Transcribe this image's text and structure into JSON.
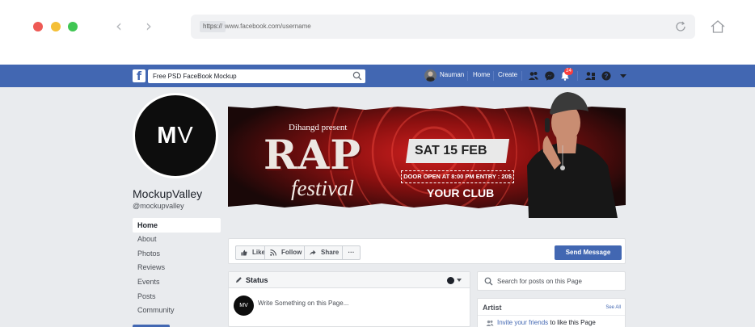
{
  "browser": {
    "url_protocol": "https://",
    "url": "www.facebook.com/username"
  },
  "fb_header": {
    "search_value": "Free PSD FaceBook Mockup",
    "username": "Nauman",
    "home_label": "Home",
    "create_label": "Create",
    "notification_count": "24",
    "brand_color": "#4267b2"
  },
  "profile": {
    "logo_text_m": "M",
    "logo_text_v": "V",
    "page_name": "MockupValley",
    "handle": "@mockupvalley"
  },
  "sidebar": {
    "active": "Home",
    "items": [
      "About",
      "Photos",
      "Reviews",
      "Events",
      "Posts",
      "Community"
    ]
  },
  "cover": {
    "presenter": "Dihangd present",
    "headline": "RAP",
    "subheadline": "festival",
    "date": "SAT 15 FEB",
    "door_info": "DOOR OPEN AT 8:00 PM  ENTRY : 20$",
    "venue": "YOUR CLUB"
  },
  "actions": {
    "like": "Like",
    "follow": "Follow",
    "share": "Share",
    "more": "···",
    "send_message": "Send Message"
  },
  "status": {
    "title": "Status",
    "avatar_text": "MV",
    "placeholder": "Write Something on this Page..."
  },
  "right_column": {
    "search_placeholder": "Search for posts on this Page",
    "artist_title": "Artist",
    "see_all": "See All",
    "invite_link": "Invite your friends",
    "invite_rest": " to like this Page"
  }
}
